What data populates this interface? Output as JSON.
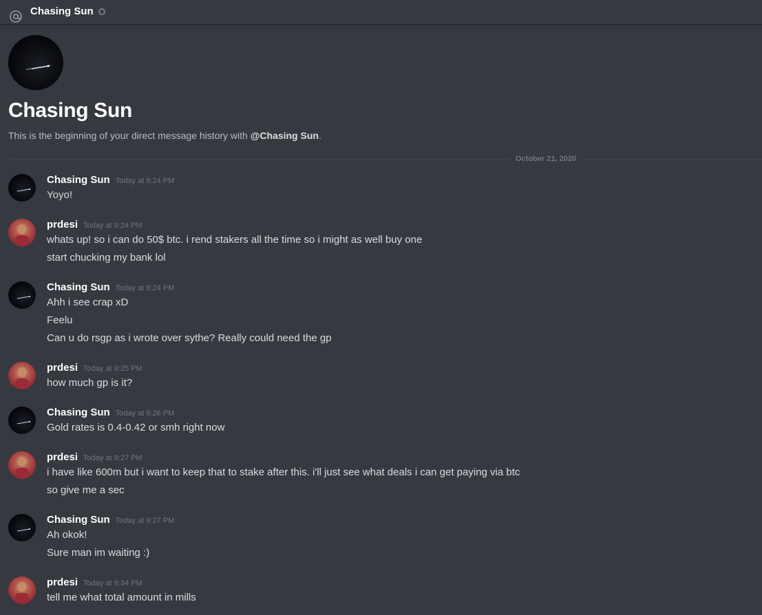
{
  "header": {
    "channel_name": "Chasing Sun",
    "at_icon": "at-sign-icon",
    "status": "offline"
  },
  "intro": {
    "title": "Chasing Sun",
    "sub_prefix": "This is the beginning of your direct message history with ",
    "sub_handle": "@Chasing Sun",
    "sub_suffix": "."
  },
  "divider": {
    "date": "October 21, 2020"
  },
  "messages": [
    {
      "author": "Chasing Sun",
      "time": "Today at 9:24 PM",
      "lines": [
        "Yoyo!"
      ]
    },
    {
      "author": "prdesi",
      "time": "Today at 9:24 PM",
      "lines": [
        "whats up! so i can do 50$ btc. i rend stakers all the time so i might as well buy one",
        "start chucking my bank lol"
      ]
    },
    {
      "author": "Chasing Sun",
      "time": "Today at 9:24 PM",
      "lines": [
        "Ahh i see crap xD",
        "Feelu",
        "Can u do rsgp as i wrote over sythe? Really could need the gp"
      ]
    },
    {
      "author": "prdesi",
      "time": "Today at 9:25 PM",
      "lines": [
        "how much gp is it?"
      ]
    },
    {
      "author": "Chasing Sun",
      "time": "Today at 9:26 PM",
      "lines": [
        "Gold rates is 0.4-0.42 or smh right now"
      ]
    },
    {
      "author": "prdesi",
      "time": "Today at 9:27 PM",
      "lines": [
        "i have like 600m but i want to keep that to stake after this. i'll just see what deals i can get paying via btc",
        "so give me a sec"
      ]
    },
    {
      "author": "Chasing Sun",
      "time": "Today at 9:27 PM",
      "lines": [
        "Ah okok!",
        "Sure man im waiting :)"
      ]
    },
    {
      "author": "prdesi",
      "time": "Today at 9:34 PM",
      "lines": [
        "tell me what total amount in mills"
      ]
    }
  ],
  "colors": {
    "background": "#36393f",
    "username": "#ffffff",
    "message_text": "#dcddde",
    "timestamp": "#72767d",
    "muted_text": "#b9bbbe"
  }
}
